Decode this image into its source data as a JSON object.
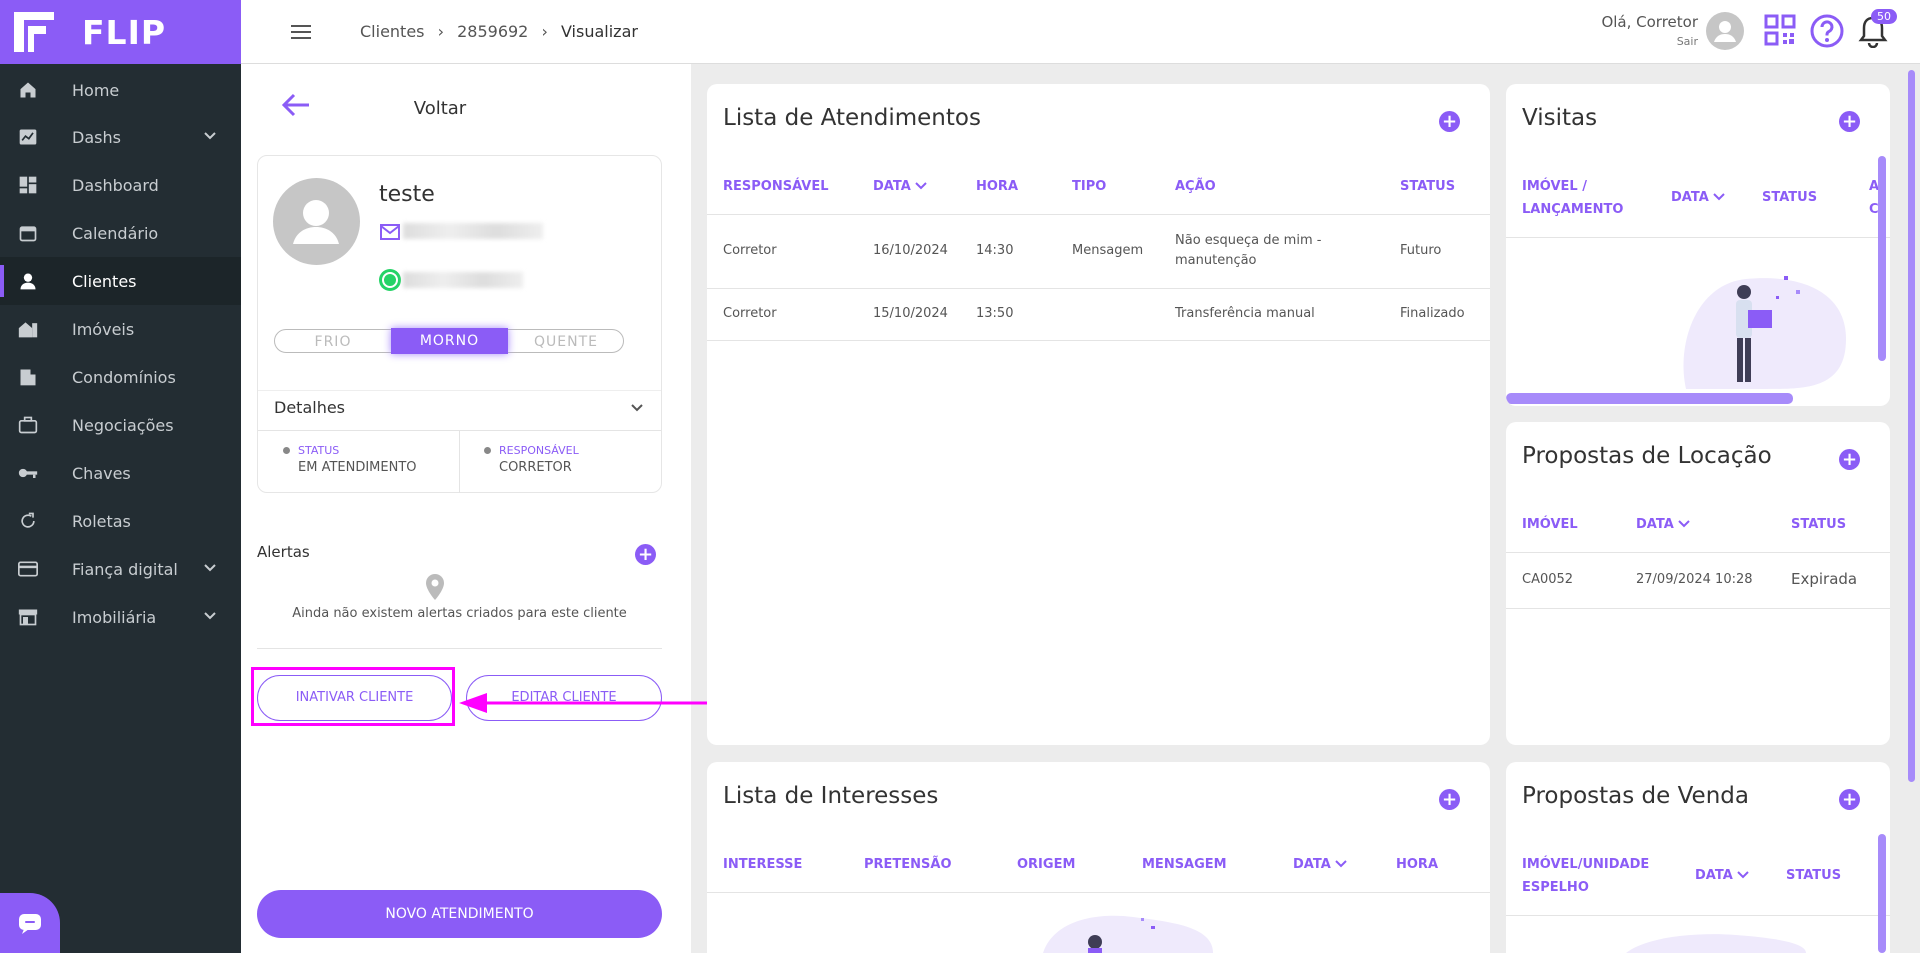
{
  "app": {
    "name": "FLIP"
  },
  "nav": {
    "items": [
      {
        "label": "Home",
        "icon": "home-icon"
      },
      {
        "label": "Dashs",
        "icon": "chart-icon"
      },
      {
        "label": "Dashboard",
        "icon": "dashboard-icon"
      },
      {
        "label": "Calendário",
        "icon": "calendar-icon"
      },
      {
        "label": "Clientes",
        "icon": "person-icon"
      },
      {
        "label": "Imóveis",
        "icon": "house-icon"
      },
      {
        "label": "Condomínios",
        "icon": "building-icon"
      },
      {
        "label": "Negociações",
        "icon": "briefcase-icon"
      },
      {
        "label": "Chaves",
        "icon": "key-icon"
      },
      {
        "label": "Roletas",
        "icon": "refresh-icon"
      },
      {
        "label": "Fiança digital",
        "icon": "card-icon"
      },
      {
        "label": "Imobiliária",
        "icon": "store-icon"
      }
    ]
  },
  "header": {
    "crumb1": "Clientes",
    "crumb2": "2859692",
    "crumb3": "Visualizar",
    "greeting": "Olá, Corretor",
    "logout": "Sair",
    "notif_count": "50"
  },
  "client": {
    "back": "Voltar",
    "name": "teste",
    "temps": [
      "FRIO",
      "MORNO",
      "QUENTE"
    ],
    "details": "Detalhes",
    "status_label": "STATUS",
    "status_value": "EM ATENDIMENTO",
    "resp_label": "RESPONSÁVEL",
    "resp_value": "CORRETOR",
    "alerts_title": "Alertas",
    "alerts_empty": "Ainda não existem alertas criados para este cliente",
    "inactivate": "INATIVAR CLIENTE",
    "edit": "EDITAR CLIENTE",
    "new_service": "NOVO ATENDIMENTO"
  },
  "atendimentos": {
    "title": "Lista de Atendimentos",
    "headers": [
      "RESPONSÁVEL",
      "DATA",
      "HORA",
      "TIPO",
      "AÇÃO",
      "STATUS"
    ],
    "rows": [
      {
        "resp": "Corretor",
        "data": "16/10/2024",
        "hora": "14:30",
        "tipo": "Mensagem",
        "acao1": "Não esqueça de mim -",
        "acao2": "manutenção",
        "status": "Futuro"
      },
      {
        "resp": "Corretor",
        "data": "15/10/2024",
        "hora": "13:50",
        "tipo": "",
        "acao1": "Transferência manual",
        "acao2": "",
        "status": "Finalizado"
      }
    ]
  },
  "visitas": {
    "title": "Visitas",
    "h_imovel1": "IMÓVEL /",
    "h_imovel2": "LANÇAMENTO",
    "h_data": "DATA",
    "h_status": "STATUS",
    "h_extra1": "A",
    "h_extra2": "C"
  },
  "locacao": {
    "title": "Propostas de Locação",
    "headers": [
      "IMÓVEL",
      "DATA",
      "STATUS"
    ],
    "row": {
      "imovel": "CA0052",
      "data": "27/09/2024 10:28",
      "status": "Expirada"
    }
  },
  "interesses": {
    "title": "Lista de Interesses",
    "headers": [
      "INTERESSE",
      "PRETENSÃO",
      "ORIGEM",
      "MENSAGEM",
      "DATA",
      "HORA"
    ]
  },
  "venda": {
    "title": "Propostas de Venda",
    "h_imovel1": "IMÓVEL/UNIDADE",
    "h_imovel2": "ESPELHO",
    "h_data": "DATA",
    "h_status": "STATUS"
  },
  "colors": {
    "accent": "#8b5cf6",
    "sidebar": "#232d33",
    "highlight": "#ff00ff"
  }
}
